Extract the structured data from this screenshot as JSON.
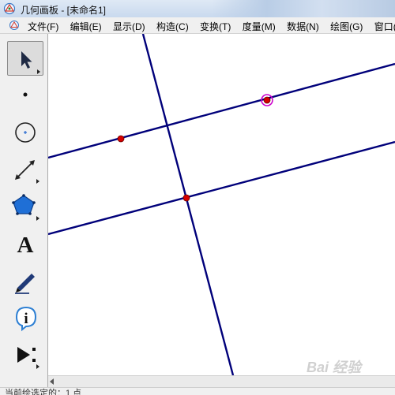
{
  "window": {
    "title": "几何画板 - [未命名1]"
  },
  "menu": {
    "items": [
      {
        "label": "文件(F)"
      },
      {
        "label": "编辑(E)"
      },
      {
        "label": "显示(D)"
      },
      {
        "label": "构造(C)"
      },
      {
        "label": "变换(T)"
      },
      {
        "label": "度量(M)"
      },
      {
        "label": "数据(N)"
      },
      {
        "label": "绘图(G)"
      },
      {
        "label": "窗口("
      }
    ]
  },
  "toolbox": {
    "tools": [
      {
        "name": "selection-arrow-tool",
        "icon": "arrow-icon",
        "selected": true
      },
      {
        "name": "point-tool",
        "icon": "point-icon"
      },
      {
        "name": "compass-tool",
        "icon": "compass-circle-icon"
      },
      {
        "name": "straightedge-tool",
        "icon": "segment-icon"
      },
      {
        "name": "polygon-tool",
        "icon": "pentagon-icon"
      },
      {
        "name": "text-tool",
        "icon": "text-a-icon",
        "glyph": "A"
      },
      {
        "name": "marker-tool",
        "icon": "pen-icon"
      },
      {
        "name": "information-tool",
        "icon": "info-icon",
        "glyph": "i"
      },
      {
        "name": "custom-tool",
        "icon": "custom-play-icon"
      }
    ]
  },
  "status": {
    "text": "当前绘选定的：1 点"
  },
  "watermark": {
    "text": "Bai 经验"
  },
  "colors": {
    "line": "#00007a",
    "point_fill": "#d40000",
    "selected_ring": "#cc00cc"
  }
}
